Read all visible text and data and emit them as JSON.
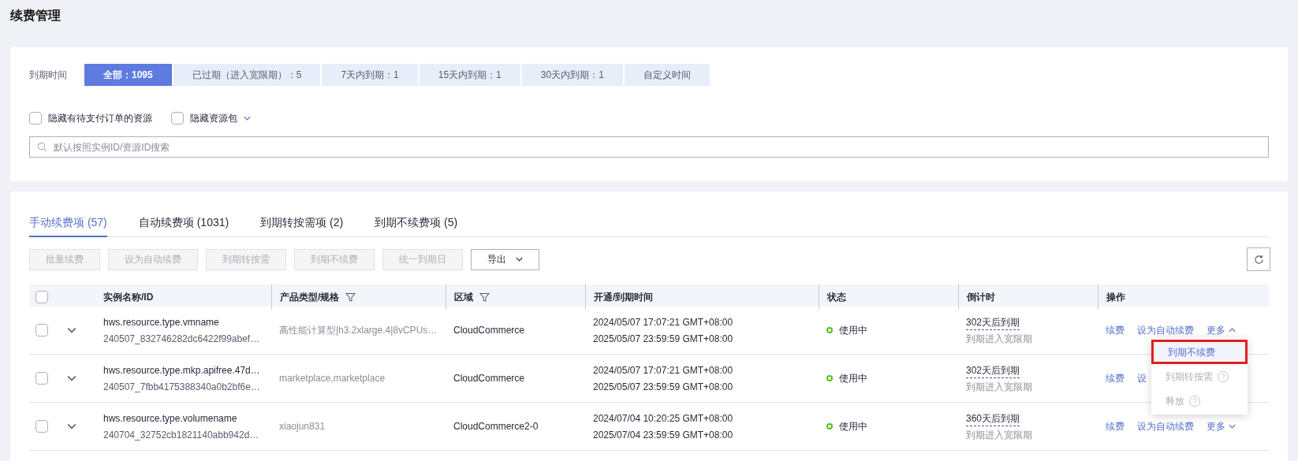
{
  "page_title": "续费管理",
  "filter": {
    "label": "到期时间",
    "options": [
      {
        "label": "全部：1095",
        "selected": true
      },
      {
        "label": "已过期（进入宽限期）：5",
        "selected": false
      },
      {
        "label": "7天内到期：1",
        "selected": false
      },
      {
        "label": "15天内到期：1",
        "selected": false
      },
      {
        "label": "30天内到期：1",
        "selected": false
      },
      {
        "label": "自定义时间",
        "selected": false
      }
    ]
  },
  "options": [
    {
      "label": "隐藏有待支付订单的资源",
      "checked": false,
      "dropdown": false
    },
    {
      "label": "隐藏资源包",
      "checked": false,
      "dropdown": true
    }
  ],
  "search": {
    "placeholder": "默认按照实例ID/资源ID搜索"
  },
  "tabs": [
    {
      "label": "手动续费项 (57)",
      "selected": true
    },
    {
      "label": "自动续费项 (1031)",
      "selected": false
    },
    {
      "label": "到期转按需项 (2)",
      "selected": false
    },
    {
      "label": "到期不续费项 (5)",
      "selected": false
    }
  ],
  "toolbar": [
    {
      "label": "批量续费",
      "disabled": true
    },
    {
      "label": "设为自动续费",
      "disabled": true
    },
    {
      "label": "到期转按需",
      "disabled": true
    },
    {
      "label": "到期不续费",
      "disabled": true
    },
    {
      "label": "统一到期日",
      "disabled": true
    }
  ],
  "export_button": "导出",
  "table": {
    "all_checked": false,
    "columns": [
      {
        "label": "实例名称/ID",
        "filter": false
      },
      {
        "label": "产品类型/规格",
        "filter": true
      },
      {
        "label": "区域",
        "filter": true
      },
      {
        "label": "开通/到期时间",
        "filter": false
      },
      {
        "label": "状态",
        "filter": false
      },
      {
        "label": "倒计时",
        "filter": false
      },
      {
        "label": "操作",
        "filter": false
      }
    ],
    "rows": [
      {
        "checked": false,
        "name": "hws.resource.type.vmname",
        "id": "240507_832746282dc6422f99abef…",
        "product": "高性能计算型|h3.2xlarge.4|8vCPUs…",
        "region": "CloudCommerce",
        "start": "2024/05/07 17:07:21 GMT+08:00",
        "end": "2025/05/07 23:59:59 GMT+08:00",
        "status": "使用中",
        "countdown": "302天后到期",
        "countdown_note": "到期进入宽限期",
        "actions": [
          "续费",
          "设为自动续费"
        ],
        "more": "更多",
        "more_expanded": true
      },
      {
        "checked": false,
        "name": "hws.resource.type.mkp.apifree.47d…",
        "id": "240507_7fbb4175388340a0b2bf6e…",
        "product": "marketplace,marketplace",
        "region": "CloudCommerce",
        "start": "2024/05/07 17:07:21 GMT+08:00",
        "end": "2025/05/07 23:59:59 GMT+08:00",
        "status": "使用中",
        "countdown": "302天后到期",
        "countdown_note": "到期进入宽限期",
        "actions": [
          "续费",
          "设"
        ]
      },
      {
        "checked": false,
        "name": "hws.resource.type.volumename",
        "id": "240704_32752cb1821140abb942d…",
        "product": "xiaojun831",
        "region": "CloudCommerce2-0",
        "start": "2024/07/04 10:20:25 GMT+08:00",
        "end": "2025/07/04 23:59:59 GMT+08:00",
        "status": "使用中",
        "countdown": "360天后到期",
        "countdown_note": "到期进入宽限期",
        "actions": [
          "续费",
          "设为自动续费"
        ],
        "more": "更多",
        "more_expanded": false
      }
    ]
  },
  "more_menu": [
    {
      "label": "到期不续费",
      "disabled": false,
      "selected": true,
      "help": false
    },
    {
      "label": "到期转按需",
      "disabled": true,
      "selected": false,
      "help": true
    },
    {
      "label": "释放",
      "disabled": true,
      "selected": false,
      "help": true
    }
  ]
}
